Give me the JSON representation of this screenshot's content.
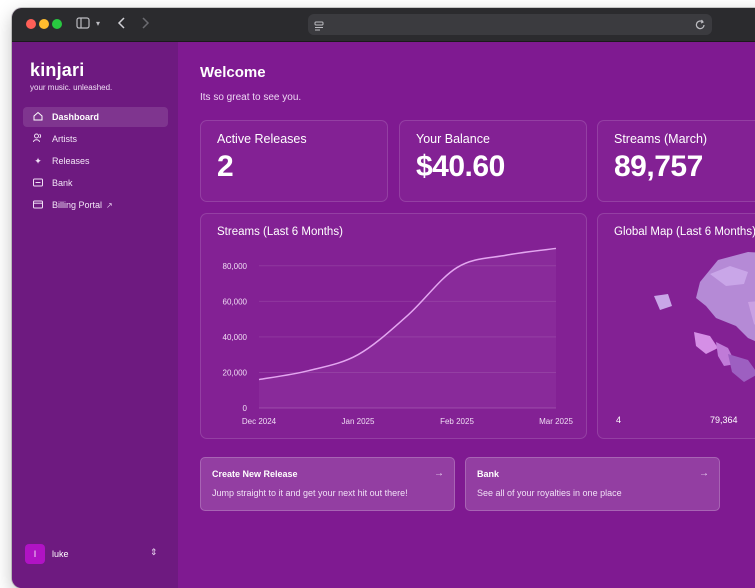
{
  "sidebar": {
    "brand": "kinjari",
    "tagline": "your music. unleashed.",
    "items": [
      {
        "label": "Dashboard",
        "icon": "home-icon",
        "active": true
      },
      {
        "label": "Artists",
        "icon": "users-icon",
        "active": false
      },
      {
        "label": "Releases",
        "icon": "sparkle-icon",
        "active": false
      },
      {
        "label": "Bank",
        "icon": "bank-icon",
        "active": false
      },
      {
        "label": "Billing Portal",
        "icon": "credit-card-icon",
        "active": false,
        "external": true
      }
    ],
    "user": {
      "initial": "l",
      "name": "luke"
    }
  },
  "header": {
    "title": "Welcome",
    "subtitle": "Its so great to see you."
  },
  "stats": [
    {
      "label": "Active Releases",
      "value": "2"
    },
    {
      "label": "Your Balance",
      "value": "$40.60"
    },
    {
      "label": "Streams (March)",
      "value": "89,757"
    }
  ],
  "chart_card_title": "Streams (Last 6 Months)",
  "map": {
    "title": "Global Map (Last 6 Months)",
    "legend_min": "4",
    "legend_max": "79,364"
  },
  "chart_data": {
    "type": "area",
    "title": "Streams (Last 6 Months)",
    "x": [
      "Dec 2024",
      "Jan 2025",
      "Feb 2025",
      "Mar 2025"
    ],
    "y_ticks": [
      "0",
      "20,000",
      "40,000",
      "60,000",
      "80,000"
    ],
    "ylim": [
      0,
      90000
    ],
    "series": [
      {
        "points": [
          [
            0,
            16000
          ],
          [
            0.5,
            21000
          ],
          [
            1,
            30000
          ],
          [
            1.5,
            52000
          ],
          [
            2,
            79000
          ],
          [
            2.5,
            86000
          ],
          [
            3,
            89757
          ]
        ]
      }
    ],
    "grid": true
  },
  "actions": [
    {
      "title": "Create New Release",
      "desc": "Jump straight to it and get your next hit out there!"
    },
    {
      "title": "Bank",
      "desc": "See all of your royalties in one place"
    }
  ],
  "colors": {
    "sidebar": "#6e1a80",
    "main": "#7f1a91",
    "accent": "#b013c4",
    "line": "#e3a6f0"
  }
}
